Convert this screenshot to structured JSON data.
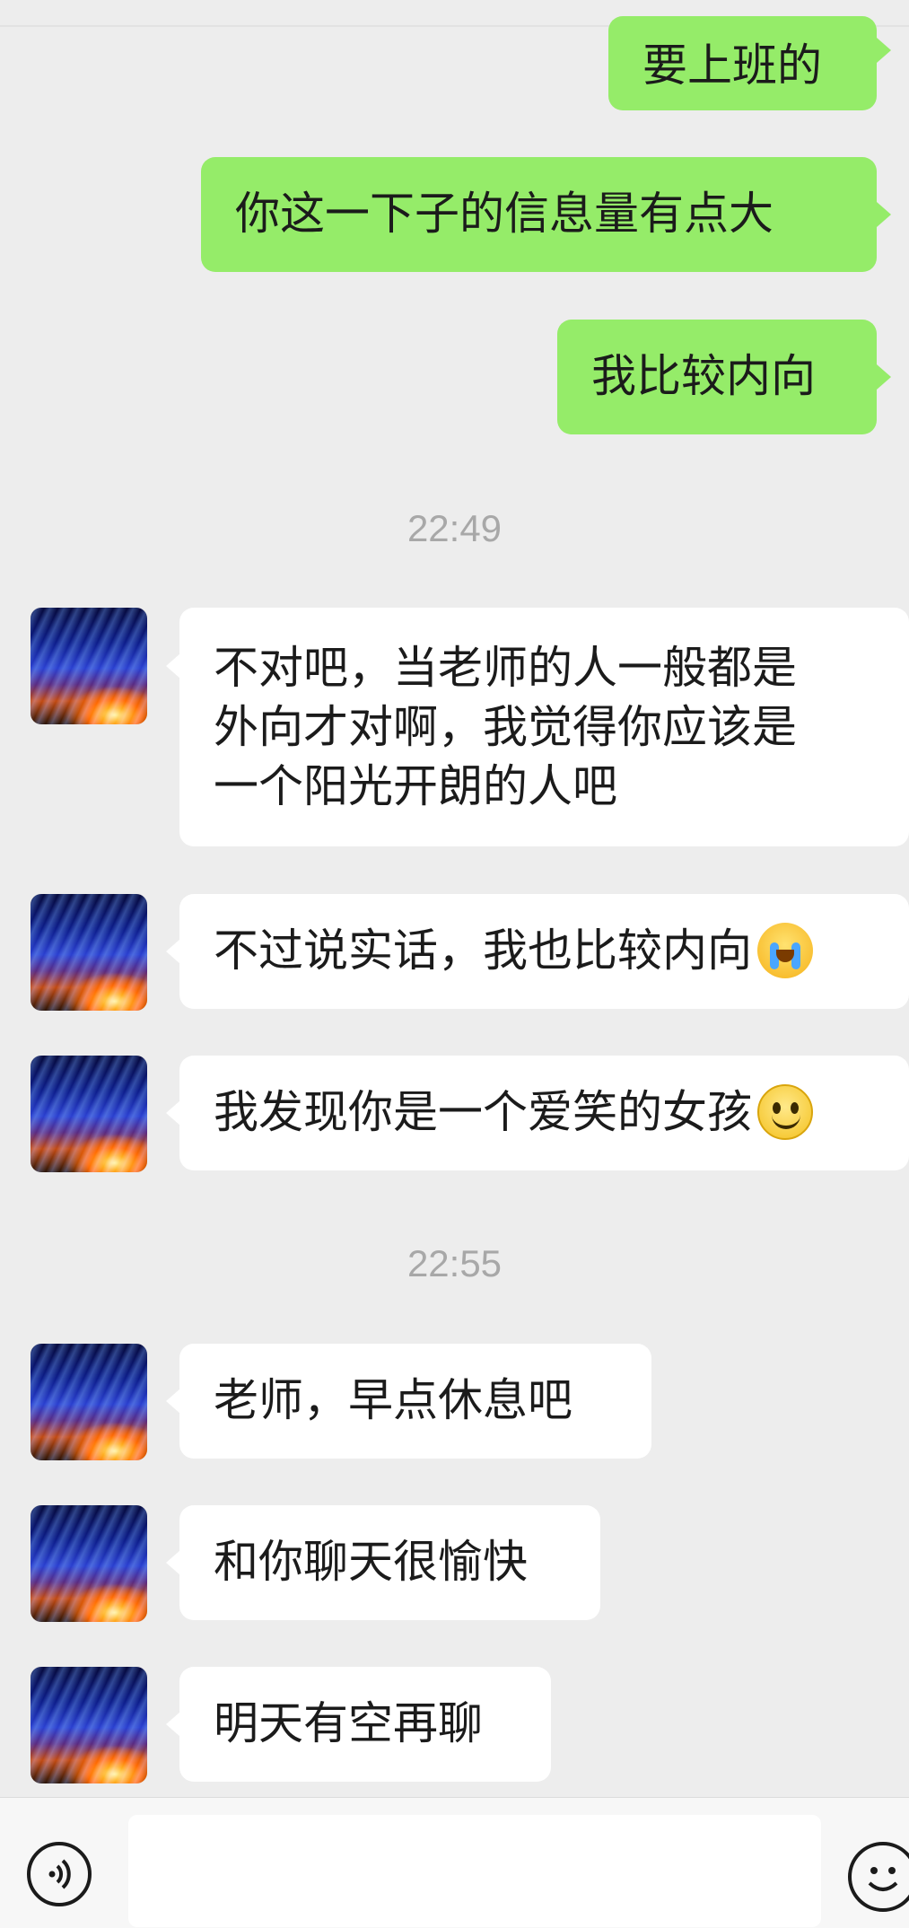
{
  "messages_right": [
    {
      "text": "要上班的"
    },
    {
      "text": "你这一下子的信息量有点大"
    },
    {
      "text": "我比较内向"
    }
  ],
  "timestamps": [
    "22:49",
    "22:55"
  ],
  "messages_left": [
    {
      "lines": [
        "不对吧，当老师的人一般都是",
        "外向才对啊，我觉得你应该是",
        "一个阳光开朗的人吧"
      ]
    },
    {
      "text": "不过说实话，我也比较内向",
      "emoji": "loudly-crying-face"
    },
    {
      "text": "我发现你是一个爱笑的女孩",
      "emoji": "smiling-face"
    },
    {
      "text": "老师，早点休息吧"
    },
    {
      "text": "和你聊天很愉快"
    },
    {
      "text": "明天有空再聊"
    }
  ],
  "colors": {
    "background": "#ededed",
    "sent_bubble": "#95ec69",
    "received_bubble": "#ffffff",
    "timestamp_text": "#a8a8a8"
  },
  "icons": {
    "voice": "voice-input-icon",
    "emoji": "emoji-keyboard-icon"
  }
}
